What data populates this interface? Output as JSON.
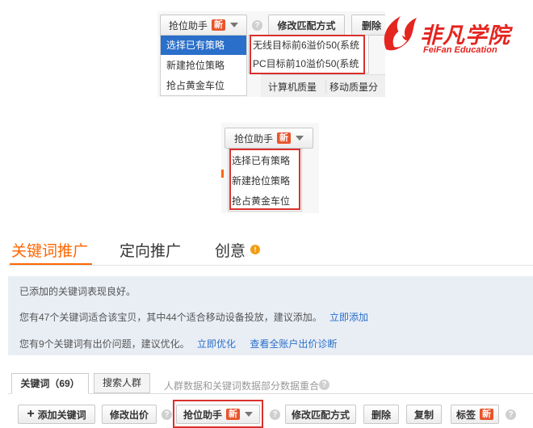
{
  "top_crop": {
    "rob_button": "抢位助手",
    "new_badge": "新",
    "modify_match_button": "修改匹配方式",
    "delete_button": "删除",
    "menu": [
      "选择已有策略",
      "新建抢位策略",
      "抢占黄金车位"
    ],
    "submenu": [
      "无线目标前6溢价50(系统",
      "PC目标前10溢价50(系统"
    ],
    "columns": [
      "计算机质量",
      "移动质量分"
    ]
  },
  "logo": {
    "cn": "非凡学院",
    "en": "FeiFan Education"
  },
  "middle_crop": {
    "rob_button": "抢位助手",
    "new_badge": "新",
    "menu": [
      "选择已有策略",
      "新建抢位策略",
      "抢占黄金车位"
    ]
  },
  "main": {
    "tabs": [
      "关键词推广",
      "定向推广",
      "创意"
    ],
    "info_lines": {
      "line1": "已添加的关键词表现良好。",
      "line2_text": "您有47个关键词适合该宝贝，其中44个适合移动设备投放，建议添加。",
      "line2_link": "立即添加",
      "line3_text": "您有9个关键词有出价问题，建议优化。",
      "line3_link1": "立即优化",
      "line3_link2": "查看全账户出价诊断"
    },
    "subtabs": {
      "keywords": "关键词（69）",
      "crowd": "搜索人群",
      "note": "人群数据和关键词数据部分数据重合"
    },
    "toolbar": {
      "add_keyword": "添加关键词",
      "modify_bid": "修改出价",
      "rob_helper": "抢位助手",
      "new_badge": "新",
      "modify_match": "修改匹配方式",
      "delete": "删除",
      "copy": "复制",
      "tag": "标签"
    }
  },
  "colors": {
    "accent": "#f60",
    "red_box": "#d9302c",
    "link": "#2a6fc9",
    "badge": "#e8542c",
    "selected": "#2a6fc9"
  }
}
